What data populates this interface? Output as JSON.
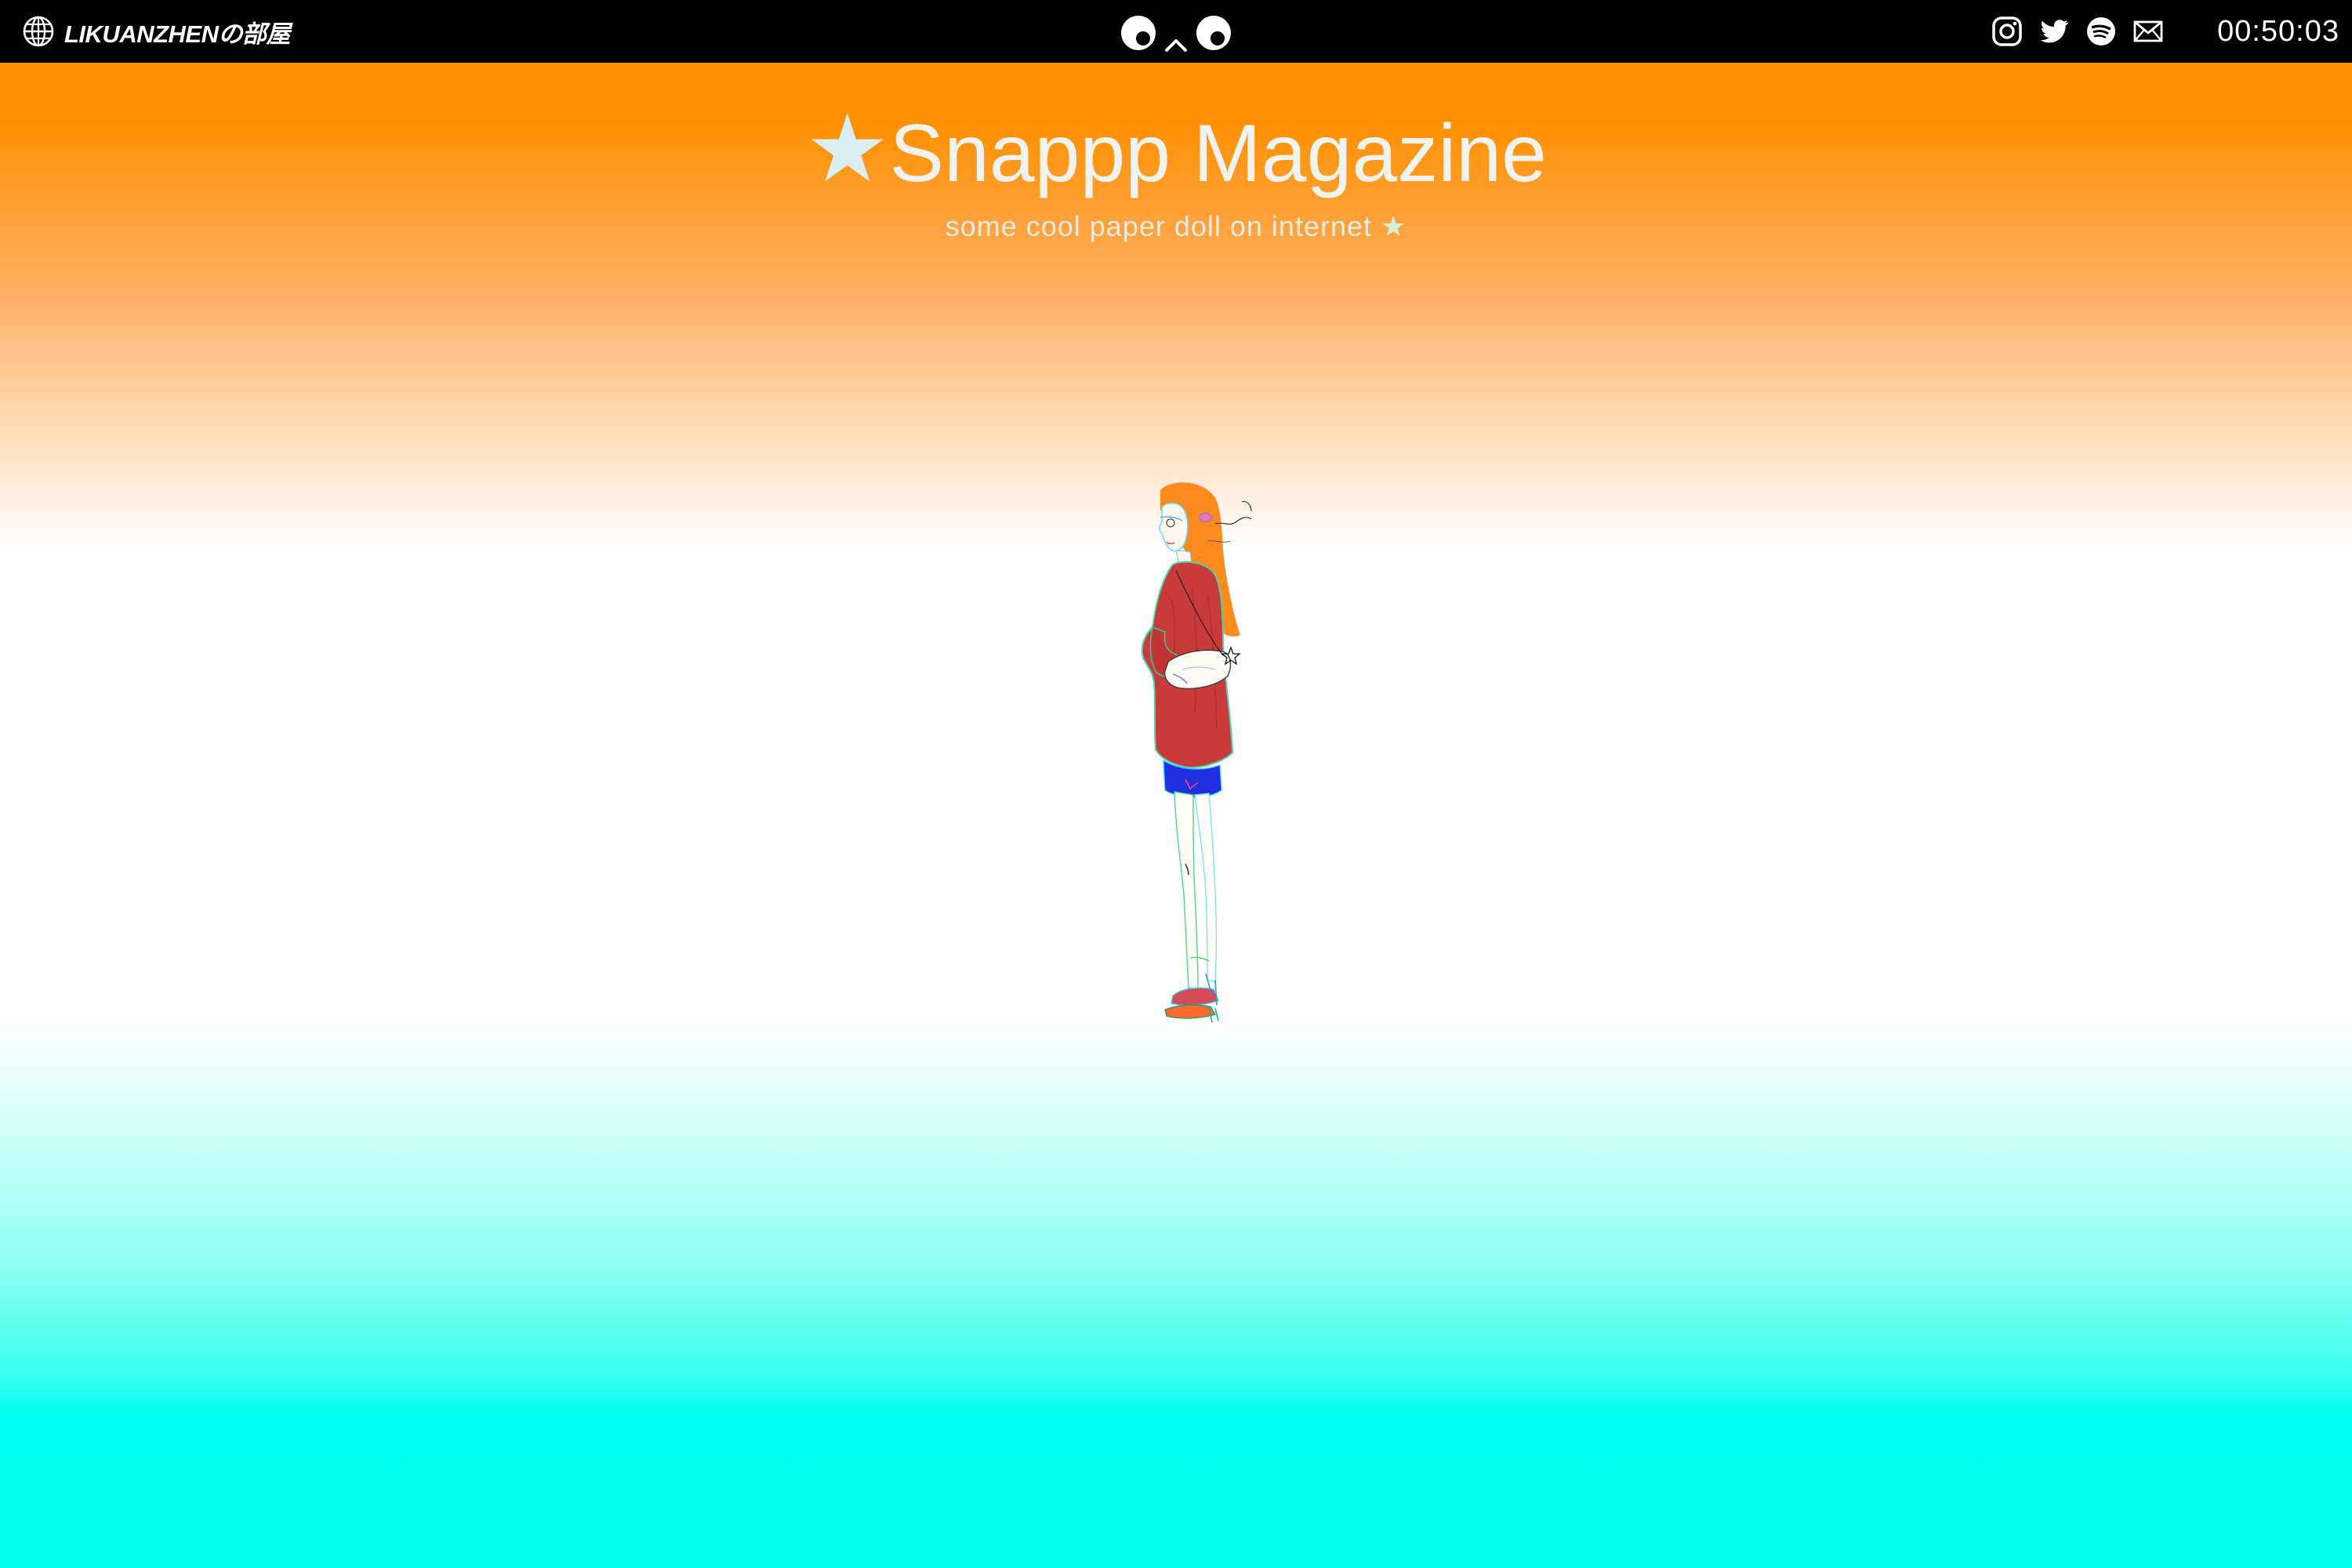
{
  "topbar": {
    "site_name": "LIKUANZHENの部屋",
    "icons": {
      "site": "globe-icon",
      "mascot": "eyes-face-icon",
      "social": [
        "instagram-icon",
        "twitter-icon",
        "spotify-icon",
        "mail-icon"
      ]
    },
    "clock": "00:50:03"
  },
  "heading": {
    "star": "★",
    "title": "Snappp Magazine",
    "subtitle": "some cool paper doll on internet",
    "subtitle_star": "★"
  },
  "figure": {
    "subject": "paper-doll-illustration"
  },
  "colors": {
    "topbar": "#000000",
    "gradient_top": "#ff8f00",
    "gradient_middle": "#ffffff",
    "gradient_bottom": "#00ffee",
    "title_text": "#f1f3ee",
    "jacket": "#c93a3a",
    "hair": "#ff8a1e",
    "shorts": "#1f2fe0"
  }
}
